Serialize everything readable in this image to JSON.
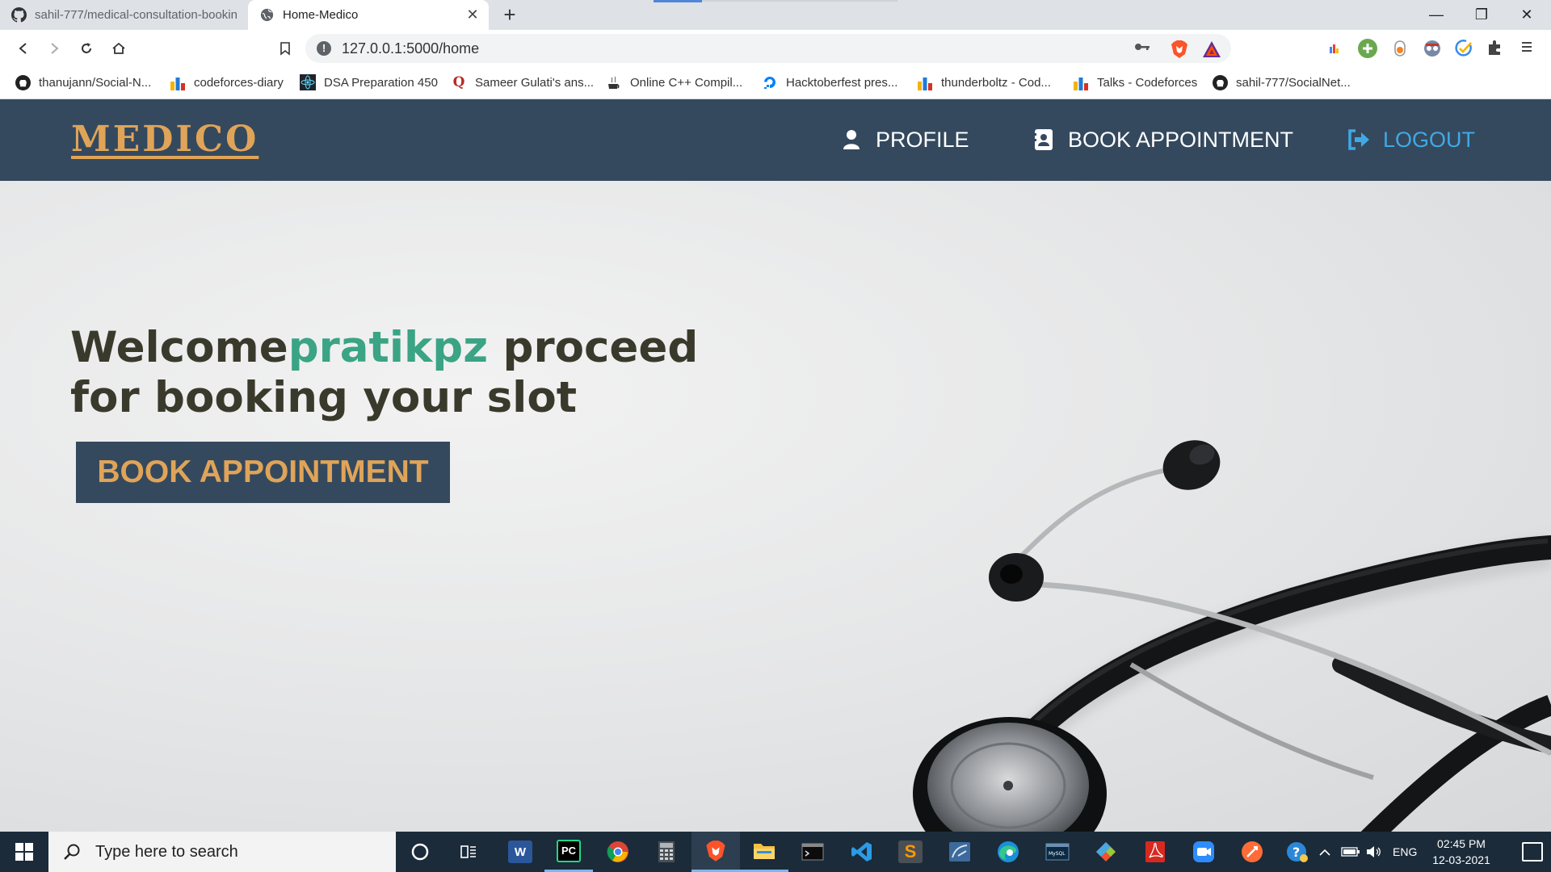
{
  "browser": {
    "tabs": [
      {
        "title": "sahil-777/medical-consultation-booking",
        "icon": "github-icon"
      },
      {
        "title": "Home-Medico",
        "icon": "globe-icon"
      }
    ],
    "url": "127.0.0.1:5000/home",
    "bookmarks": [
      {
        "label": "thanujann/Social-N...",
        "icon": "github-icon"
      },
      {
        "label": "codeforces-diary",
        "icon": "codeforces-icon"
      },
      {
        "label": "DSA Preparation 450",
        "icon": "react-icon"
      },
      {
        "label": "Sameer Gulati's ans...",
        "icon": "quora-icon"
      },
      {
        "label": "Online C++ Compil...",
        "icon": "cpp-icon"
      },
      {
        "label": "Hacktoberfest pres...",
        "icon": "digitalocean-icon"
      },
      {
        "label": "thunderboltz - Cod...",
        "icon": "codeforces-icon"
      },
      {
        "label": "Talks - Codeforces",
        "icon": "codeforces-icon"
      },
      {
        "label": "sahil-777/SocialNet...",
        "icon": "github-icon"
      }
    ]
  },
  "site": {
    "brand": "MEDICO",
    "nav": {
      "profile": "PROFILE",
      "book": "BOOK APPOINTMENT",
      "logout": "LOGOUT"
    },
    "hero": {
      "welcome": "Welcome",
      "username": "pratikpz",
      "rest": " proceed for booking your slot",
      "button": "BOOK APPOINTMENT"
    },
    "colors": {
      "navbar": "#34495e",
      "accent": "#e0a458",
      "username": "#3aa485",
      "logout": "#3fa9e6"
    }
  },
  "taskbar": {
    "search_placeholder": "Type here to search",
    "language": "ENG",
    "time": "02:45 PM",
    "date": "12-03-2021"
  }
}
